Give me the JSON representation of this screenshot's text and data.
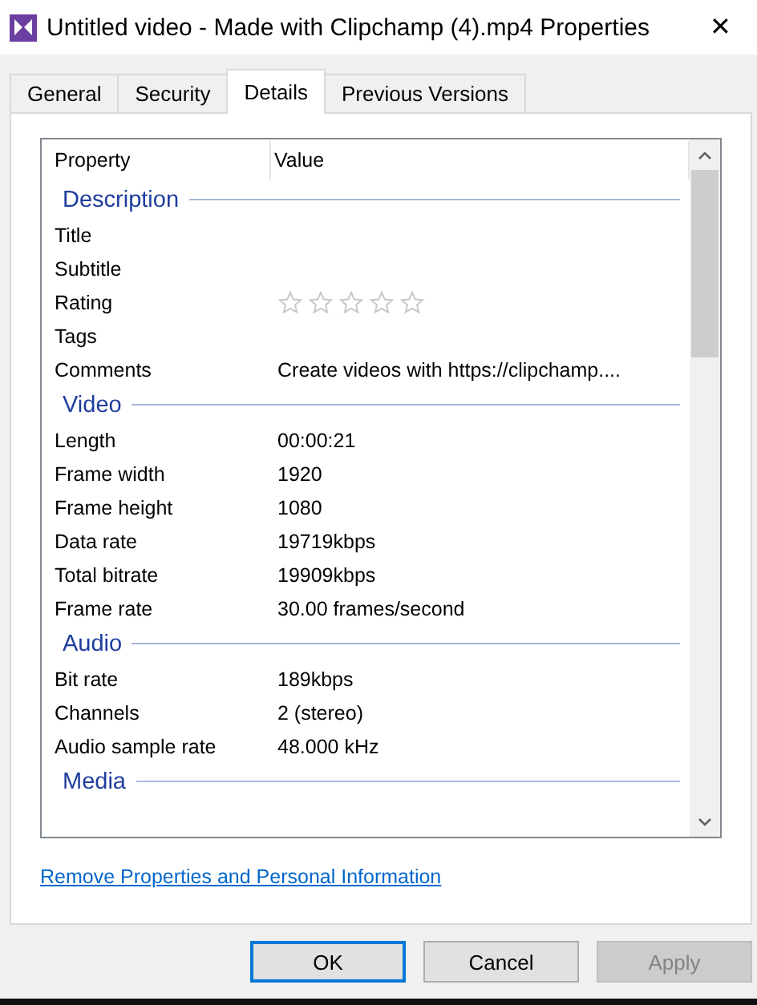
{
  "window": {
    "title": "Untitled video - Made with Clipchamp (4).mp4 Properties",
    "close": "✕"
  },
  "tabs": [
    {
      "label": "General",
      "selected": false
    },
    {
      "label": "Security",
      "selected": false
    },
    {
      "label": "Details",
      "selected": true
    },
    {
      "label": "Previous Versions",
      "selected": false
    }
  ],
  "table": {
    "columns": [
      "Property",
      "Value"
    ],
    "sections": [
      {
        "title": "Description",
        "rows": [
          {
            "kind": "text",
            "property": "Title"
          },
          {
            "kind": "text",
            "property": "Subtitle"
          },
          {
            "kind": "rating",
            "property": "Rating",
            "stars": 0
          },
          {
            "kind": "text",
            "property": "Tags"
          },
          {
            "kind": "text",
            "property": "Comments",
            "value": "Create videos with https://clipchamp...."
          }
        ]
      },
      {
        "title": "Video",
        "rows": [
          {
            "kind": "text",
            "property": "Length",
            "value": "00:00:21"
          },
          {
            "kind": "text",
            "property": "Frame width",
            "value": "1920"
          },
          {
            "kind": "text",
            "property": "Frame height",
            "value": "1080"
          },
          {
            "kind": "text",
            "property": "Data rate",
            "value": "19719kbps"
          },
          {
            "kind": "text",
            "property": "Total bitrate",
            "value": "19909kbps"
          },
          {
            "kind": "text",
            "property": "Frame rate",
            "value": "30.00 frames/second"
          }
        ]
      },
      {
        "title": "Audio",
        "rows": [
          {
            "kind": "text",
            "property": "Bit rate",
            "value": "189kbps"
          },
          {
            "kind": "text",
            "property": "Channels",
            "value": "2 (stereo)"
          },
          {
            "kind": "text",
            "property": "Audio sample rate",
            "value": "48.000 kHz"
          }
        ]
      },
      {
        "title": "Media"
      }
    ]
  },
  "link": "Remove Properties and Personal Information",
  "buttons": [
    {
      "label": "OK",
      "disabled": false,
      "default": true
    },
    {
      "label": "Cancel",
      "disabled": false,
      "default": false
    },
    {
      "label": "Apply",
      "disabled": true,
      "default": false
    }
  ]
}
